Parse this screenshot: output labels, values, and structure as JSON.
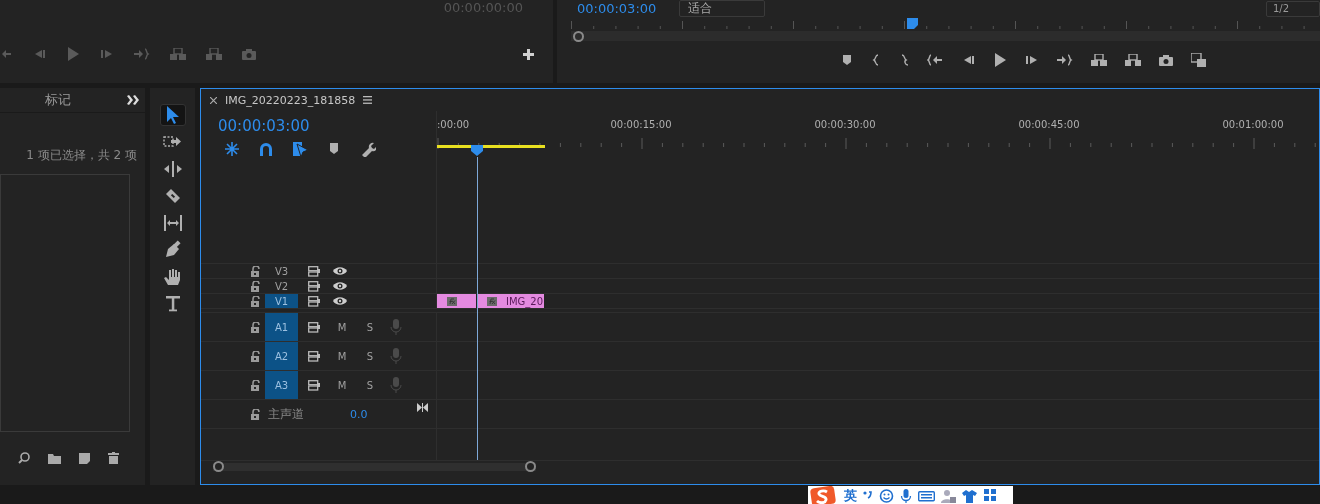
{
  "source_monitor": {
    "timecode": "00:00:00:00"
  },
  "program_monitor": {
    "timecode": "00:00:03:00",
    "fit": "适合",
    "resolution": "1/2"
  },
  "project_panel": {
    "tabs": [
      {
        "label": "标记",
        "selected": false
      }
    ],
    "selection_info": "1 项已选择，共 2 项"
  },
  "tools": [
    {
      "kind": "selection",
      "selected": true
    },
    {
      "kind": "track-select",
      "selected": false
    },
    {
      "kind": "ripple",
      "selected": false
    },
    {
      "kind": "razor",
      "selected": false
    },
    {
      "kind": "slip",
      "selected": false
    },
    {
      "kind": "pen",
      "selected": false
    },
    {
      "kind": "hand",
      "selected": false
    },
    {
      "kind": "type",
      "selected": false
    }
  ],
  "timeline": {
    "tab_title": "IMG_20220223_181858",
    "timecode": "00:00:03:00",
    "toggles": [
      {
        "kind": "nest",
        "on": true
      },
      {
        "kind": "snap",
        "on": true
      },
      {
        "kind": "linked",
        "on": true
      },
      {
        "kind": "marker",
        "on": false
      },
      {
        "kind": "settings",
        "on": false
      }
    ],
    "ruler_labels": [
      ":00:00",
      "00:00:15:00",
      "00:00:30:00",
      "00:00:45:00",
      "00:01:00:00"
    ],
    "video_tracks": [
      {
        "name": "V3",
        "targeted": false
      },
      {
        "name": "V2",
        "targeted": false
      },
      {
        "name": "V1",
        "targeted": true
      }
    ],
    "audio_tracks": [
      {
        "name": "A1",
        "targeted": true,
        "mute": "M",
        "solo": "S"
      },
      {
        "name": "A2",
        "targeted": true,
        "mute": "M",
        "solo": "S"
      },
      {
        "name": "A3",
        "targeted": true,
        "mute": "M",
        "solo": "S"
      }
    ],
    "master": {
      "label": "主声道",
      "value": "0.0"
    },
    "clips": [
      {
        "effects": true
      },
      {
        "effects": true,
        "label": "IMG_20"
      }
    ]
  },
  "ime_bar": {
    "mode": "英"
  }
}
